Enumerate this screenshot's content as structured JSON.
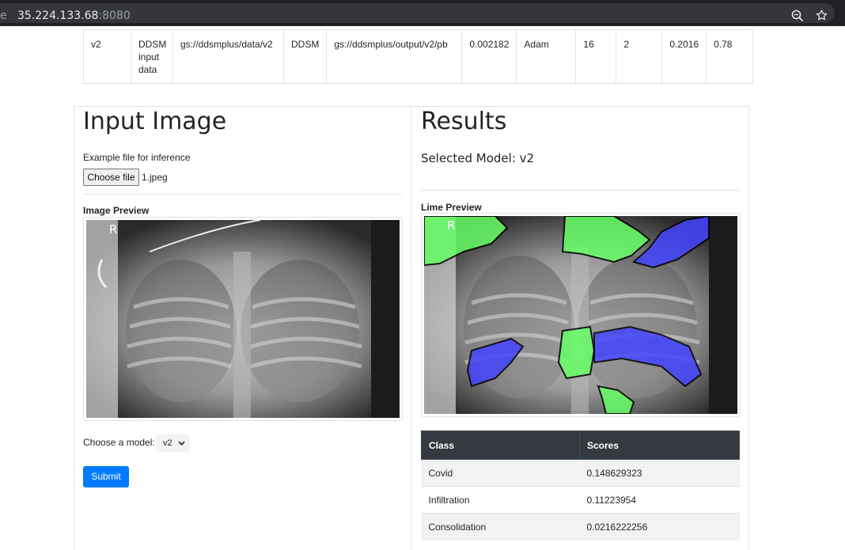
{
  "browser": {
    "tab_prefix": "e",
    "host": "35.224.133.68",
    "port": ":8080"
  },
  "model_table": {
    "row": [
      "v2",
      "DDSM input data",
      "gs://ddsmplus/data/v2",
      "DDSM",
      "gs://ddsmplus/output/v2/pb",
      "0.002182",
      "Adam",
      "16",
      "2",
      "0.2016",
      "0.78"
    ]
  },
  "input_panel": {
    "title": "Input Image",
    "example_label": "Example file for inference",
    "choose_file_label": "Choose file",
    "file_name": "1.jpeg",
    "preview_label": "Image Preview",
    "xray_marker": "R",
    "model_label": "Choose a model:",
    "model_selected": "v2",
    "submit_label": "Submit"
  },
  "results_panel": {
    "title": "Results",
    "selected_model": "Selected Model: v2",
    "lime_label": "Lime Preview",
    "lime_marker": "R",
    "table_headers": [
      "Class",
      "Scores"
    ],
    "rows": [
      {
        "class": "Covid",
        "score": "0.148629323"
      },
      {
        "class": "Infiltration",
        "score": "0.11223954"
      },
      {
        "class": "Consolidation",
        "score": "0.0216222256"
      }
    ]
  },
  "colors": {
    "primary_button": "#007bff",
    "table_header": "#343a40",
    "lime_positive": "#66ff66",
    "lime_negative": "#4444ff"
  },
  "icons": [
    "zoom-icon",
    "star-icon",
    "chevron-down-icon"
  ]
}
